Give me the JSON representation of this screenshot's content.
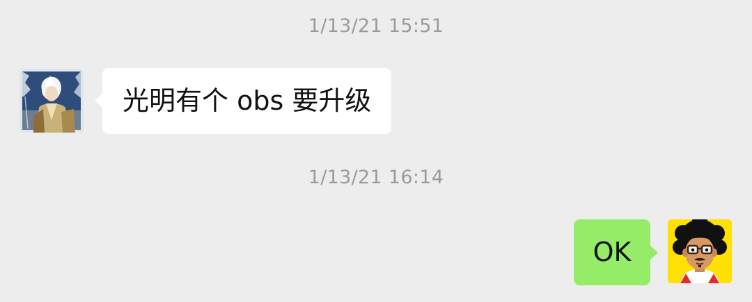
{
  "messages": [
    {
      "timestamp": "1/13/21 15:51",
      "direction": "incoming",
      "text": "光明有个 obs 要升级",
      "avatar_icon": "anime-warrior-avatar"
    },
    {
      "timestamp": "1/13/21 16:14",
      "direction": "outgoing",
      "text": "OK",
      "avatar_icon": "cartoon-man-glasses-avatar"
    }
  ],
  "colors": {
    "background": "#ededed",
    "incoming_bubble": "#ffffff",
    "outgoing_bubble": "#95ec69",
    "timestamp_text": "#9a9a9a"
  }
}
